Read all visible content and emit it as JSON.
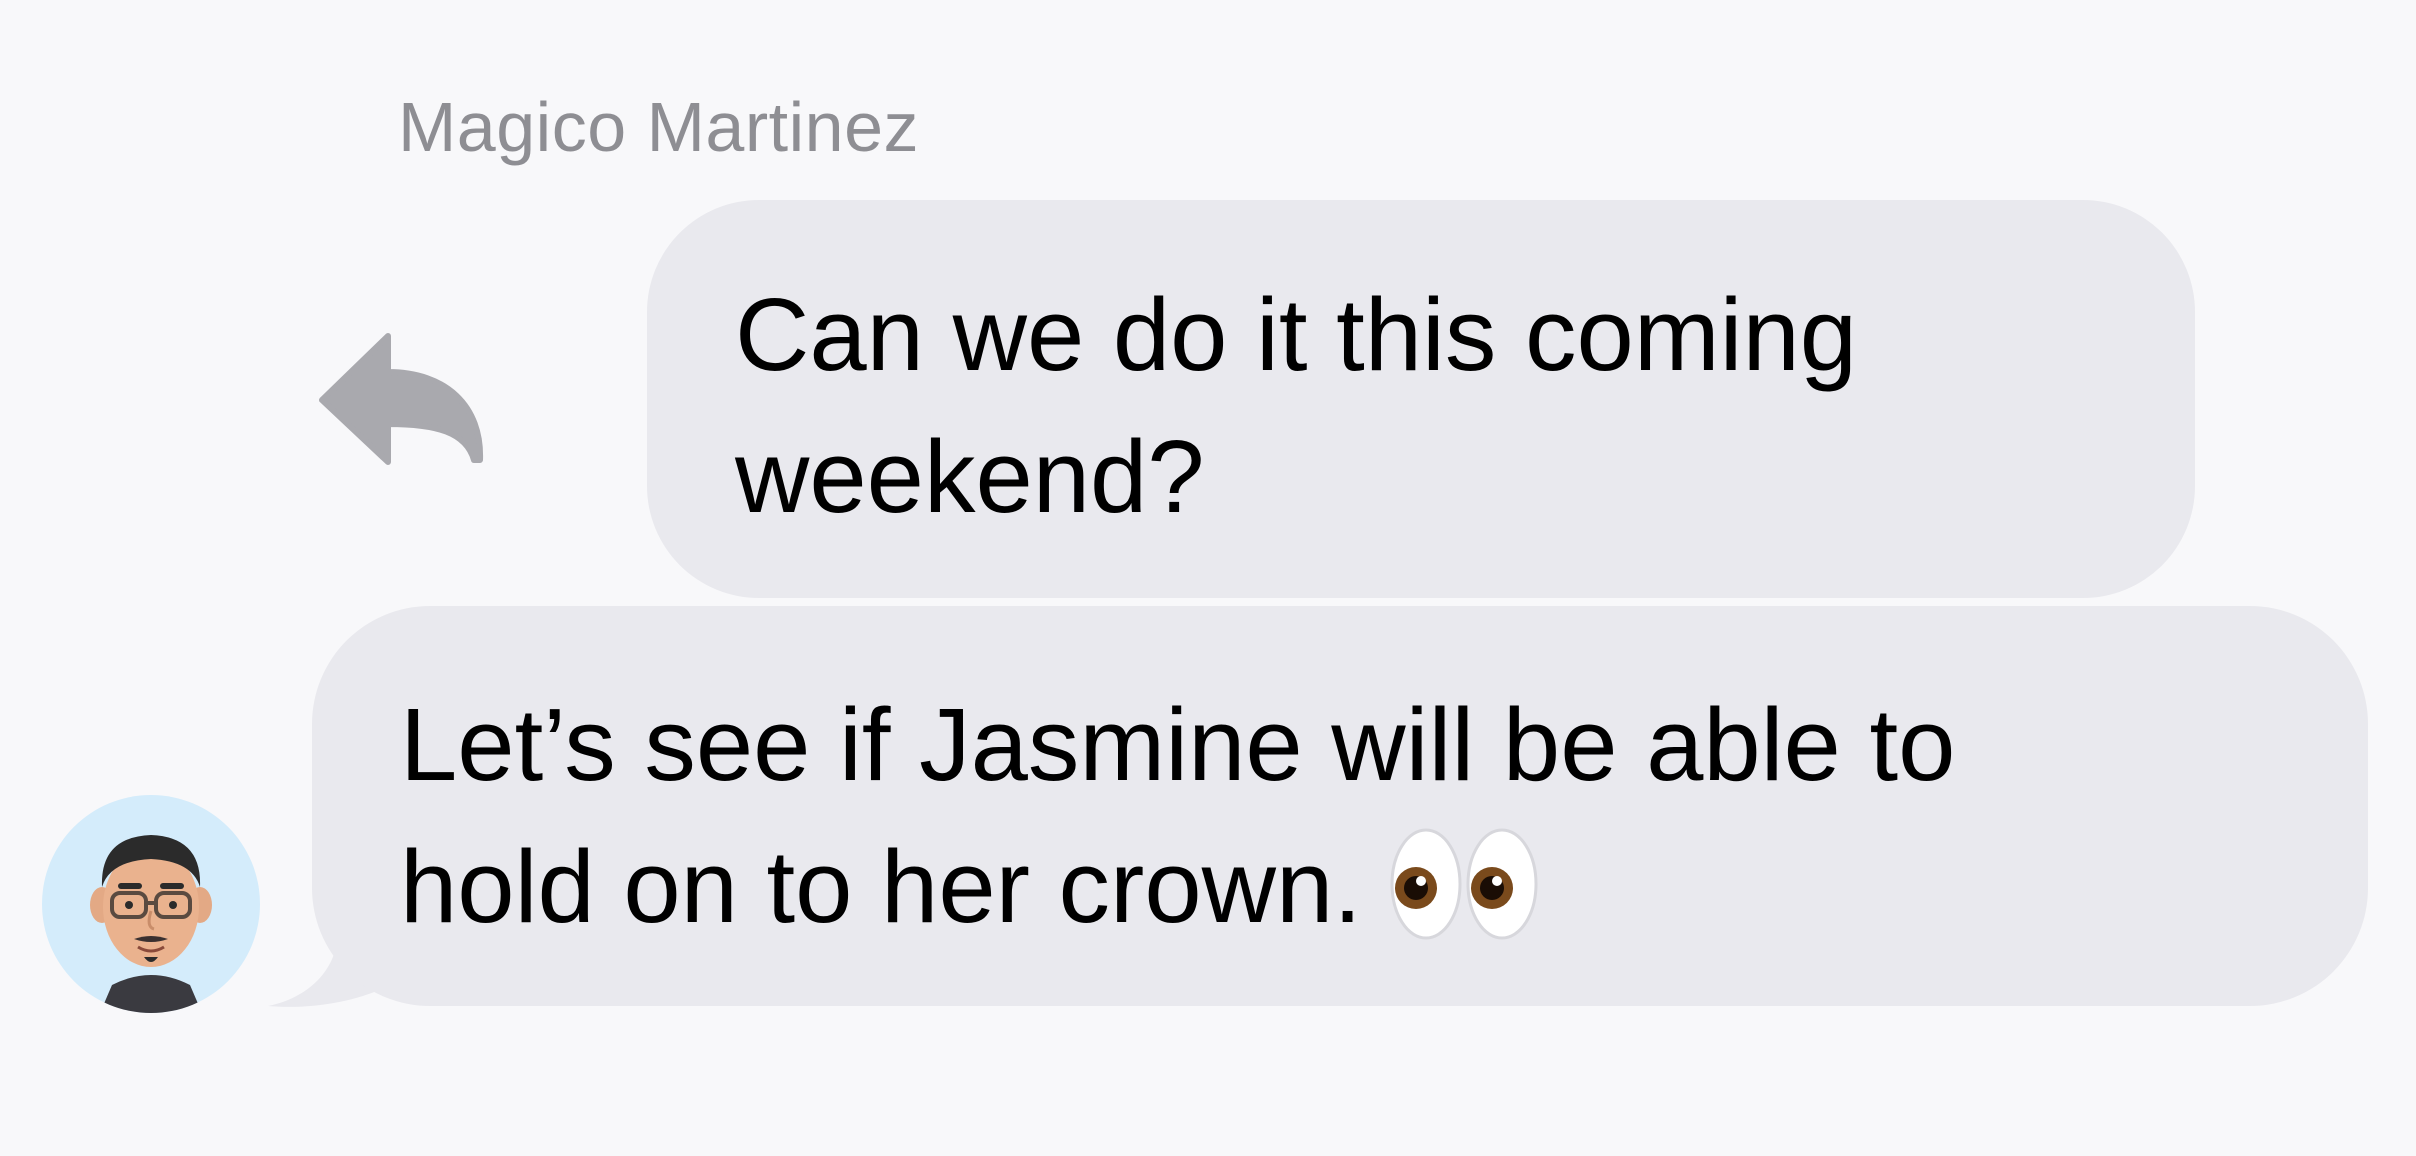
{
  "thread": {
    "sender_name": "Magico Martinez",
    "quoted_message": {
      "text": "Can we do it this coming\nweekend?"
    },
    "reply_message": {
      "text": "Let’s see if Jasmine will be able to\nhold on to her crown.",
      "emoji": "eyes-emoji"
    },
    "icons": {
      "reply": "reply-arrow-icon",
      "avatar": "memoji-avatar"
    },
    "colors": {
      "background": "#f8f8fa",
      "bubble": "#e9e9ee",
      "sender_name": "#8e8e93",
      "reply_icon": "#a9a9ae",
      "avatar_bg": "#d4ecfb"
    }
  }
}
